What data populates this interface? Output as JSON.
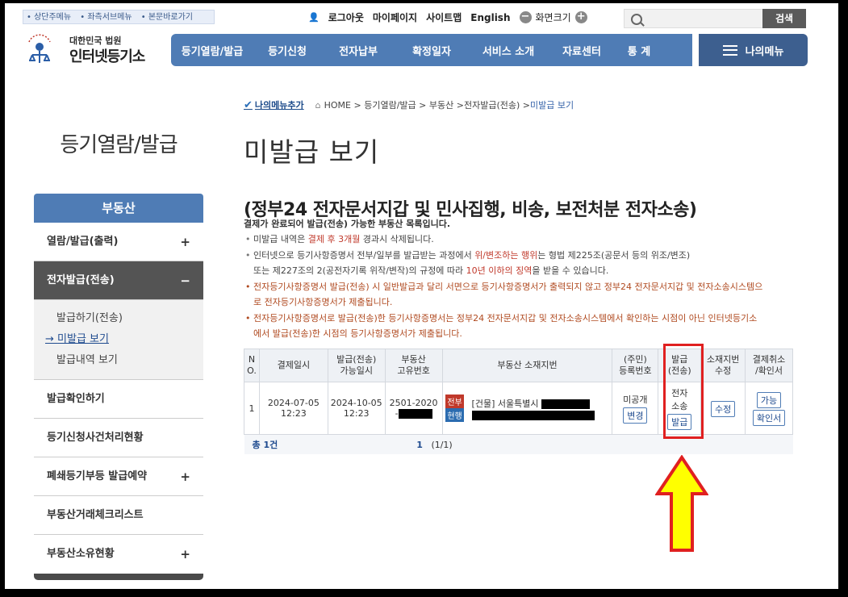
{
  "skip_links": [
    "상단주메뉴",
    "좌측서브메뉴",
    "본문바로가기"
  ],
  "util": {
    "logout": "로그아웃",
    "mypage": "마이페이지",
    "sitemap": "사이트맵",
    "english": "English",
    "screen_size": "화면크기",
    "zoom_out": "−",
    "zoom_in": "+",
    "search_button": "검색"
  },
  "logo": {
    "line1": "대한민국 법원",
    "line2": "인터넷등기소"
  },
  "nav": [
    "등기열람/발급",
    "등기신청",
    "전자납부",
    "확정일자",
    "서비스 소개",
    "자료센터",
    "통 계"
  ],
  "mymenu": "나의메뉴",
  "breadcrumb": {
    "add": "나의메뉴추가",
    "items": [
      "HOME",
      "등기열람/발급",
      "부동산",
      "전자발급(전송)",
      "미발급 보기"
    ]
  },
  "sidebar": {
    "title": "등기열람/발급",
    "head": "부동산",
    "items": [
      {
        "label": "열람/발급(출력)",
        "toggle": "+"
      },
      {
        "label": "전자발급(전송)",
        "toggle": "−"
      }
    ],
    "sub": [
      "발급하기(전송)",
      "미발급 보기",
      "발급내역 보기"
    ],
    "more": [
      {
        "label": "발급확인하기",
        "toggle": ""
      },
      {
        "label": "등기신청사건처리현황",
        "toggle": ""
      },
      {
        "label": "폐쇄등기부등 발급예약",
        "toggle": "+"
      },
      {
        "label": "부동산거래체크리스트",
        "toggle": ""
      },
      {
        "label": "부동산소유현황",
        "toggle": "+"
      }
    ]
  },
  "main": {
    "title": "미발급 보기",
    "subtitle": "(정부24 전자문서지갑 및 민사집행, 비송, 보전처분 전자소송)",
    "desc": "결제가 완료되어 발급(전송) 가능한 부동산 목록입니다.",
    "notes": {
      "n1_a": "미발급 내역은 ",
      "n1_hl": "결제 후 3개월",
      "n1_b": " 경과시 삭제됩니다.",
      "n2_a": "인터넷으로 등기사항증명서 전부/일부를 발급받는 과정에서 ",
      "n2_hl1": "위/변조하는 행위",
      "n2_b": "는 형법 제225조(공문서 등의 위조/변조)",
      "n2_c_a": "또는 제227조의 2(공전자기록 위작/변작)의 규정에 따라 ",
      "n2_c_hl": "10년 이하의 징역",
      "n2_c_b": "을 받을 수 있습니다.",
      "n3_a": "전자등기사항증명서 발급(전송) 시 일반발급과 달리 서면으로 등기사항증명서가 출력되지 않고 정부24 전자문서지갑 및 전자소송시스템으",
      "n3_b": "로 전자등기사항증명서가 제출됩니다.",
      "n4_a": "전자등기사항증명서로 발급(전송)한 등기사항증명서는 정부24 전자문서지갑 및 전자소송시스템에서 확인하는 시점이 아닌 인터넷등기소",
      "n4_b": "에서 발급(전송)한 시점의 등기사항증명서가 제출됩니다."
    }
  },
  "table": {
    "headers": {
      "no": [
        "N",
        "O."
      ],
      "pay_date": "결제일시",
      "issue_until": [
        "발급(전송)",
        "가능일시"
      ],
      "unique_no": [
        "부동산",
        "고유번호"
      ],
      "address": "부동산 소재지번",
      "reg_no": [
        "(주민)",
        "등록번호"
      ],
      "issue": [
        "발급",
        "(전송)"
      ],
      "addr_edit": [
        "소재지번",
        "수정"
      ],
      "cancel": [
        "결제취소",
        "/확인서"
      ]
    },
    "row": {
      "no": "1",
      "pay_date": "2024-07-05",
      "pay_time": "12:23",
      "until_date": "2024-10-05",
      "until_time": "12:23",
      "unique_no": "2501-2020",
      "unique_no_2": "-",
      "tag1": "전부",
      "tag2": "현행",
      "address_prefix": "[건물] 서울특별시",
      "reg_status": "미공개",
      "reg_button": "변경",
      "issue_label_1": "전자",
      "issue_label_2": "소송",
      "issue_button": "발급",
      "edit_button": "수정",
      "cancel_button": "가능",
      "receipt_button": "확인서"
    },
    "footer": {
      "total": "총 1건",
      "page_current": "1",
      "page_info": "(1/1)"
    }
  },
  "colors": {
    "nav_blue": "#4f7cb5",
    "tag_red": "#c0392b",
    "tag_blue": "#2b6cb0",
    "highlight_red": "#e02020",
    "arrow_yellow": "#ffff00"
  }
}
